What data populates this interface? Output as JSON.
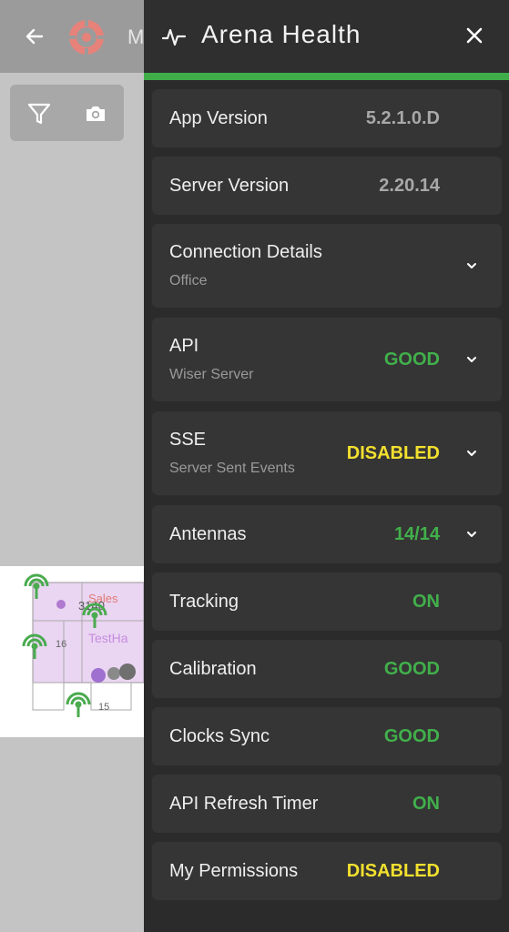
{
  "background": {
    "title_fragment": "M",
    "map_labels": [
      "Sales",
      "3140",
      "TestHa",
      "16",
      "15"
    ]
  },
  "drawer": {
    "title": "Arena Health",
    "items": [
      {
        "label": "App Version",
        "value": "5.2.1.0.D",
        "value_color": "#a8a8a8"
      },
      {
        "label": "Server Version",
        "value": "2.20.14",
        "value_color": "#a8a8a8"
      },
      {
        "label": "Connection Details",
        "sublabel": "Office",
        "expandable": true
      },
      {
        "label": "API",
        "sublabel": "Wiser Server",
        "value": "GOOD",
        "value_color": "#41b04b",
        "expandable": true
      },
      {
        "label": "SSE",
        "sublabel": "Server Sent Events",
        "value": "DISABLED",
        "value_color": "#f2e02e",
        "expandable": true
      },
      {
        "label": "Antennas",
        "value": "14/14",
        "value_color": "#41b04b",
        "expandable": true
      },
      {
        "label": "Tracking",
        "value": "ON",
        "value_color": "#41b04b"
      },
      {
        "label": "Calibration",
        "value": "GOOD",
        "value_color": "#41b04b"
      },
      {
        "label": "Clocks Sync",
        "value": "GOOD",
        "value_color": "#41b04b"
      },
      {
        "label": "API Refresh Timer",
        "value": "ON",
        "value_color": "#41b04b"
      },
      {
        "label": "My Permissions",
        "value": "DISABLED",
        "value_color": "#f2e02e"
      }
    ]
  },
  "colors": {
    "accent": "#3fae49",
    "good": "#41b04b",
    "warning": "#f2e02e",
    "drawer_bg": "#2b2b2b",
    "card_bg": "#353535"
  },
  "icons": [
    "back-arrow-icon",
    "logo-icon",
    "filter-icon",
    "camera-icon",
    "pulse-icon",
    "close-icon",
    "chevron-down-icon",
    "antenna-icon"
  ]
}
